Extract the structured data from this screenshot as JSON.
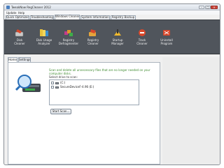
{
  "window": {
    "title": "TweakNow RegCleaner 2012"
  },
  "menu": [
    "Update",
    "Help"
  ],
  "top_tabs": [
    "Quick Optimizer",
    "Troubleshooting",
    "Windows Cleaner",
    "System Information",
    "Registry Backup"
  ],
  "active_top_tab": "Windows Cleaner",
  "tools": [
    {
      "label": "Disk\nCleaner",
      "icon": "disk-cleaner-icon"
    },
    {
      "label": "Disk Usage\nAnalyzer",
      "icon": "disk-usage-analyzer-icon"
    },
    {
      "label": "Registry\nDefragmenter",
      "icon": "registry-defragmenter-icon"
    },
    {
      "label": "Registry\nCleaner",
      "icon": "registry-cleaner-icon"
    },
    {
      "label": "Startup\nManager",
      "icon": "startup-manager-icon"
    },
    {
      "label": "Track\nCleaner",
      "icon": "track-cleaner-icon"
    },
    {
      "label": "Uninstall\nProgram",
      "icon": "uninstall-program-icon"
    }
  ],
  "sub_tabs": [
    "Home",
    "Settings"
  ],
  "active_sub_tab": "Home",
  "panel": {
    "heading": "Scan and delete all unnecessary files that are no longer needed on your computer disks.",
    "select_label": "Select drive to scan:",
    "drives": [
      {
        "label": "(C:)",
        "checked": false
      },
      {
        "label": "SecureDeviceF-4.96 (E:)",
        "checked": false
      }
    ],
    "button": "Start Scan..."
  },
  "colors": {
    "ribbon": "#50555c",
    "heading_text": "#3d8a2e",
    "close_button": "#c9453a"
  }
}
